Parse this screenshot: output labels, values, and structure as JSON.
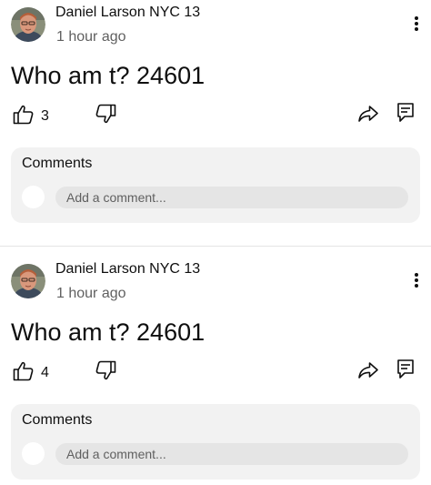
{
  "posts": [
    {
      "author": "Daniel Larson NYC 13",
      "time": "1 hour ago",
      "text": "Who am t? 24601",
      "likes": "3",
      "comments": {
        "title": "Comments",
        "placeholder": "Add a comment..."
      }
    },
    {
      "author": "Daniel Larson NYC 13",
      "time": "1 hour ago",
      "text": "Who am t? 24601",
      "likes": "4",
      "comments": {
        "title": "Comments",
        "placeholder": "Add a comment..."
      }
    }
  ],
  "icons": {
    "menu": "more-vert-icon",
    "like": "thumb-up-icon",
    "dislike": "thumb-down-icon",
    "share": "share-icon",
    "reply": "comment-icon"
  },
  "colors": {
    "text": "#0f0f0f",
    "secondary": "#606060",
    "comments_bg": "#f2f2f2",
    "input_bg": "#e5e5e5"
  }
}
